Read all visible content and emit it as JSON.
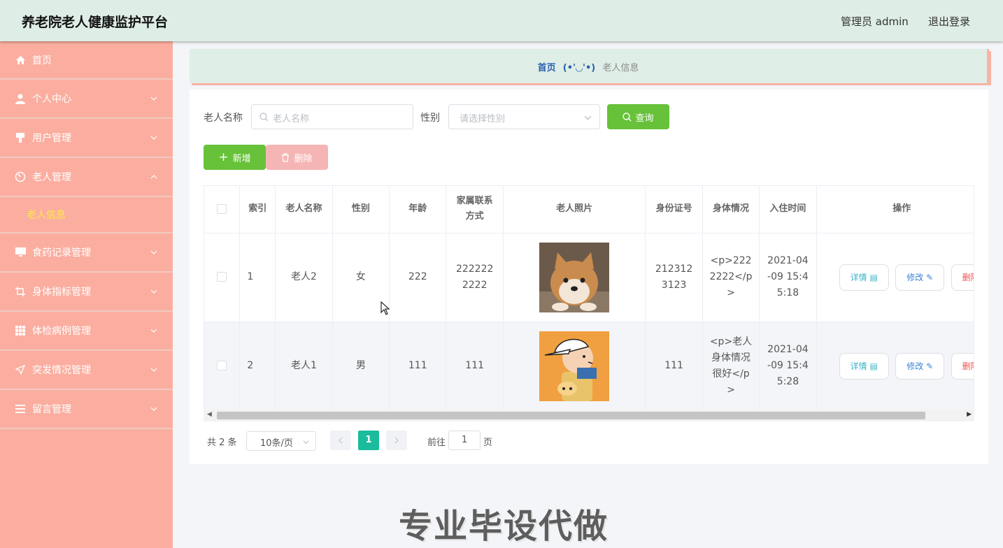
{
  "header": {
    "title": "养老院老人健康监护平台",
    "user": "管理员 admin",
    "logout": "退出登录"
  },
  "sidebar": {
    "items": [
      {
        "label": "首页",
        "icon": "home-icon"
      },
      {
        "label": "个人中心",
        "icon": "user-icon"
      },
      {
        "label": "用户管理",
        "icon": "brush-icon"
      },
      {
        "label": "老人管理",
        "icon": "dashboard-icon"
      },
      {
        "label": "食药记录管理",
        "icon": "monitor-icon"
      },
      {
        "label": "身体指标管理",
        "icon": "crop-icon"
      },
      {
        "label": "体检病例管理",
        "icon": "grid-icon"
      },
      {
        "label": "突发情况管理",
        "icon": "send-icon"
      },
      {
        "label": "留言管理",
        "icon": "list-icon"
      }
    ],
    "submenu": "老人信息"
  },
  "breadcrumb": {
    "home": "首页",
    "separator": "(•'◡'•)",
    "current": "老人信息"
  },
  "search": {
    "name_label": "老人名称",
    "name_placeholder": "老人名称",
    "gender_label": "性别",
    "gender_placeholder": "请选择性别",
    "query_button": "查询"
  },
  "actions": {
    "add": "新增",
    "delete": "删除"
  },
  "table": {
    "headers": [
      "索引",
      "老人名称",
      "性别",
      "年龄",
      "家属联系方式",
      "老人照片",
      "身份证号",
      "身体情况",
      "入住时间",
      "操作"
    ],
    "rows": [
      {
        "index": "1",
        "name": "老人2",
        "gender": "女",
        "age": "222",
        "contact": "2222222222",
        "photo": "shiba-dog-photo",
        "id": "2123123123",
        "health": "<p>2222222</p>",
        "checkin": "2021-04-09 15:45:18"
      },
      {
        "index": "2",
        "name": "老人1",
        "gender": "男",
        "age": "111",
        "contact": "111",
        "photo": "cartoon-boy-photo",
        "id": "111",
        "health": "<p>老人身体情况很好</p>",
        "checkin": "2021-04-09 15:45:28"
      }
    ],
    "op_labels": {
      "detail": "详情",
      "edit": "修改",
      "delete": "删除"
    }
  },
  "pagination": {
    "total": "共 2 条",
    "page_size": "10条/页",
    "current_page": "1",
    "goto_label": "前往",
    "goto_value": "1",
    "page_suffix": "页"
  },
  "watermark": "专业毕设代做",
  "colors": {
    "sidebar": "#fbaea0",
    "header": "#deeee6",
    "green": "#67c23a",
    "active": "#ffe84a"
  }
}
